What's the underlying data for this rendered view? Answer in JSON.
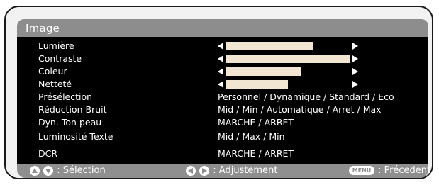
{
  "title": "Image",
  "colors": {
    "frame_border": "#1a1a1a",
    "frame_bg": "#f2f2f2",
    "titlebar": "#8d8d8d",
    "menu_bg": "#000000",
    "text": "#ffffff",
    "slider_fill": "#f1e6d2"
  },
  "rows": [
    {
      "label": "Lumière",
      "type": "slider",
      "level": 0.7
    },
    {
      "label": "Contraste",
      "type": "slider",
      "level": 1.0
    },
    {
      "label": "Coleur",
      "type": "slider",
      "level": 0.6
    },
    {
      "label": "Netteté",
      "type": "slider",
      "level": 0.5
    },
    {
      "label": "Présélection",
      "type": "text",
      "value": "Personnel / Dynamique / Standard / Eco"
    },
    {
      "label": "Réduction Bruit",
      "type": "text",
      "value": "Mid / Min /  Automatique / Arret / Max"
    },
    {
      "label": "Dyn. Ton peau",
      "type": "text",
      "value": "MARCHE / ARRET"
    },
    {
      "label": "Luminosité Texte",
      "type": "text",
      "value": "Mid / Max / Min"
    },
    {
      "label": "DCR",
      "type": "text",
      "value": "MARCHE / ARRET"
    }
  ],
  "footer": {
    "select_text": ": Sélection",
    "adjust_text": ": Adjustement",
    "menu_button_label": "MENU",
    "back_text": ": Précedent",
    "select_icon": "up-down-buttons",
    "adjust_icon": "left-right-buttons",
    "back_icon": "menu-button"
  }
}
